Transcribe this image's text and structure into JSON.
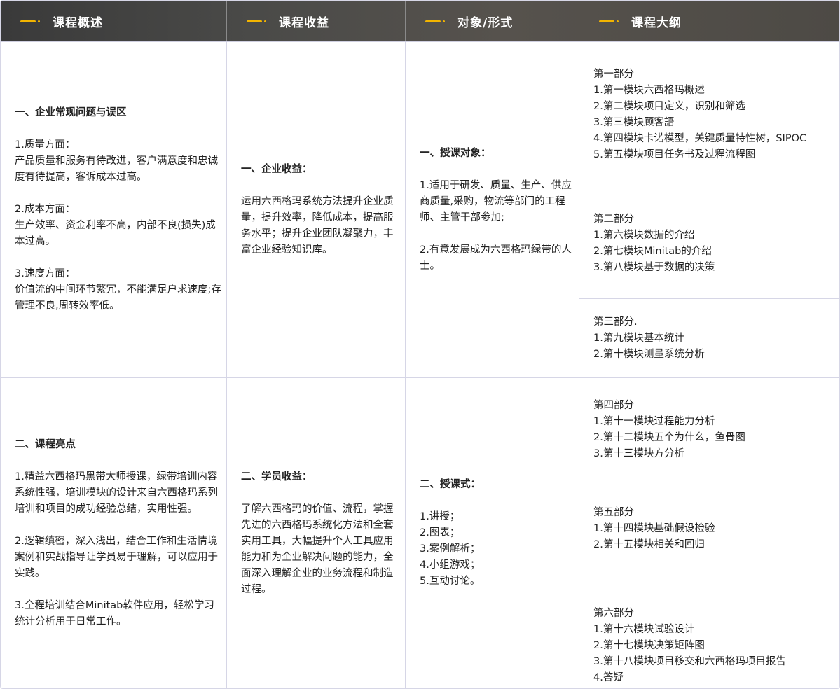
{
  "header": {
    "tabs": [
      {
        "label": "课程概述"
      },
      {
        "label": "课程收益"
      },
      {
        "label": "对象/形式"
      },
      {
        "label": "课程大纲"
      }
    ]
  },
  "overview": {
    "section1": {
      "heading": "一、企业常现问题与误区",
      "body": "1.质量方面：\n产品质量和服务有待改进，客户满意度和忠诚度有待提高，客诉成本过高。\n\n2.成本方面：\n生产效率、资金利率不高，内部不良(损失)成本过高。\n\n3.速度方面：\n价值流的中间环节繁冗，不能满足户求速度;存管理不良,周转效率低。"
    },
    "section2": {
      "heading": "二、课程亮点",
      "body": "1.精益六西格玛黑带大师授课，绿带培训内容系统性强，培训模块的设计来自六西格玛系列培训和项目的成功经验总结，实用性强。\n\n2.逻辑缜密，深入浅出，结合工作和生活情境案例和实战指导让学员易于理解，可以应用于实践。\n\n3.全程培训结合Minitab软件应用，轻松学习统计分析用于日常工作。"
    }
  },
  "benefits": {
    "section1": {
      "heading": "一、企业收益：",
      "body": "运用六西格玛系统方法提升企业质量，提升效率，降低成本，提高服务水平；提升企业团队凝聚力，丰富企业经验知识库。"
    },
    "section2": {
      "heading": "二、学员收益：",
      "body": "了解六西格玛的价值、流程，掌握先进的六西格玛系统化方法和全套实用工具，大幅提升个人工具应用能力和为企业解决问题的能力，全面深入理解企业的业务流程和制造过程。"
    }
  },
  "audience": {
    "section1": {
      "heading": "一、授课对象：",
      "body": "1.适用于研发、质量、生产、供应商质量,采购，物流等部门的工程师、主管干部参加;\n\n2.有意发展成为六西格玛绿带的人士。"
    },
    "section2": {
      "heading": "二、授课式：",
      "body": "1.讲授；\n2.图表；\n3.案例解析；\n4.小组游戏；\n5.互动讨论。"
    }
  },
  "outline": {
    "parts": [
      {
        "text": "第一部分\n1.第一模块六西格玛概述\n2.第二模块项目定义，识别和筛选\n3.第三模块顾客語\n4.第四模块卡诺模型，关键质量特性树，SIPOC\n5.第五模块项目任务书及过程流程图"
      },
      {
        "text": "第二部分\n1.第六模块数据的介绍\n2.第七模块Minitab的介绍\n3.第八模块基于数据的决策"
      },
      {
        "text": "第三部分.\n1.第九模块基本统计\n2.第十模块测量系统分析"
      },
      {
        "text": "第四部分\n1.第十一模块过程能力分析\n2.第十二模块五个为什么，鱼骨图\n3.第十三模块方分析"
      },
      {
        "text": "第五部分\n1.第十四模块基础假设检验\n2.第十五模块相关和回归"
      },
      {
        "text": "第六部分\n1.第十六模块试验设计\n2.第十七模块决策矩阵图\n3.第十八模块项目移交和六西格玛项目报告\n4.答疑"
      }
    ]
  }
}
